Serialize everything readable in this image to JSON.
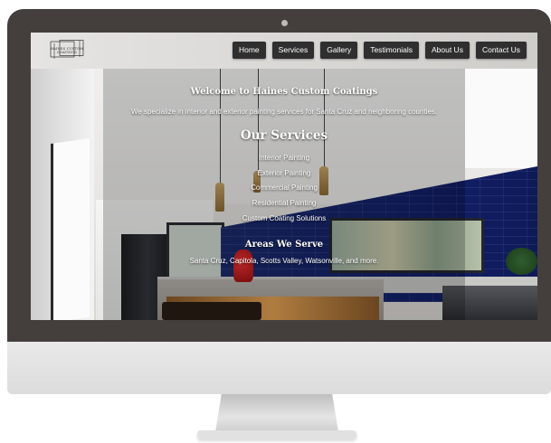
{
  "site": {
    "logo_text": "HAINES CUSTOM COATINGS",
    "nav": [
      "Home",
      "Services",
      "Gallery",
      "Testimonials",
      "About Us",
      "Contact Us"
    ]
  },
  "hero": {
    "welcome": "Welcome to Haines Custom Coatings",
    "tagline": "We specialize in interior and exterior painting services for Santa Cruz and neighboring counties."
  },
  "services": {
    "title": "Our Services",
    "items": [
      "Interior Painting",
      "Exterior Painting",
      "Commercial Painting",
      "Residential Painting",
      "Custom Coating Solutions"
    ]
  },
  "areas": {
    "title": "Areas We Serve",
    "text": "Santa Cruz, Capitola, Scotts Valley, Watsonville, and more."
  },
  "colors": {
    "bezel": "#443f3c",
    "nav_button": "#2f2f2f",
    "tile_blue": "#13206a"
  },
  "icons": [
    "logo-mark",
    "camera-dot"
  ]
}
